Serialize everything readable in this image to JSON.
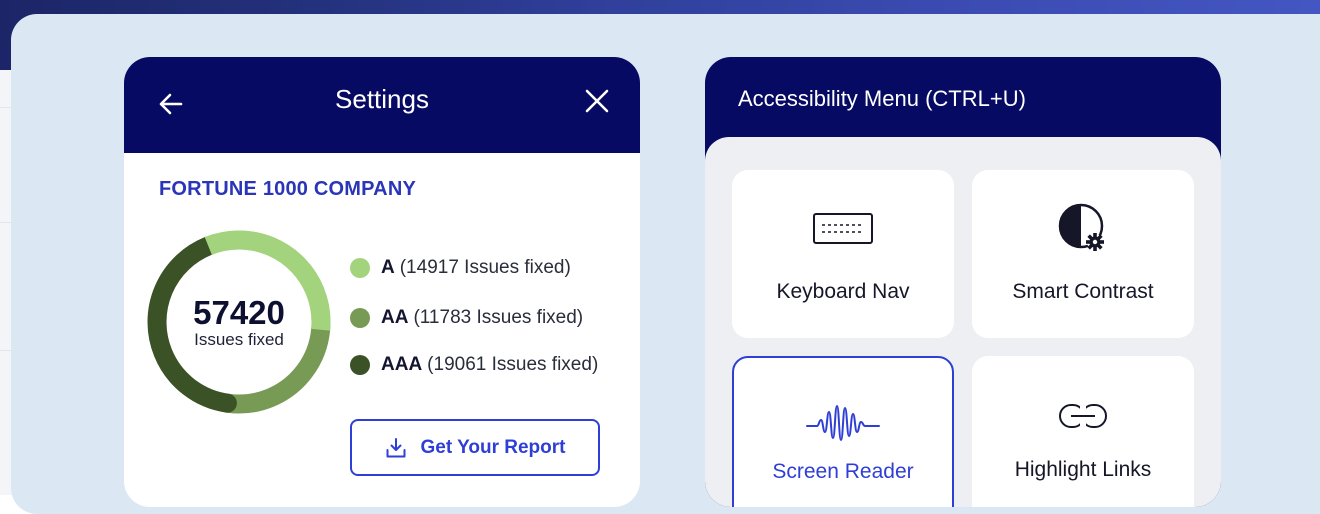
{
  "settings": {
    "title": "Settings",
    "back_icon": "arrow-left-icon",
    "close_icon": "close-icon",
    "company": "FORTUNE 1000 COMPANY",
    "total_issues": "57420",
    "total_label": "Issues fixed",
    "legend": [
      {
        "level": "A",
        "text": "(14917 Issues fixed)",
        "color": "#a3d47d",
        "value": 14917
      },
      {
        "level": "AA",
        "text": "(11783 Issues fixed)",
        "color": "#779a54",
        "value": 11783
      },
      {
        "level": "AAA",
        "text": "(19061 Issues fixed)",
        "color": "#3a5226",
        "value": 19061
      }
    ],
    "report_button": "Get Your Report",
    "report_icon": "download-icon"
  },
  "accessibility": {
    "title": "Accessibility Menu (CTRL+U)",
    "tiles": [
      {
        "label": "Keyboard Nav",
        "icon": "keyboard-icon",
        "active": false
      },
      {
        "label": "Smart Contrast",
        "icon": "contrast-icon",
        "active": false
      },
      {
        "label": "Screen Reader",
        "icon": "soundwave-icon",
        "active": true
      },
      {
        "label": "Highlight Links",
        "icon": "link-icon",
        "active": false
      }
    ]
  },
  "colors": {
    "header_navy": "#070a62",
    "accent_blue": "#2f3fd6",
    "company_blue": "#2a35b8",
    "stage_bg": "#dbe8f4"
  }
}
